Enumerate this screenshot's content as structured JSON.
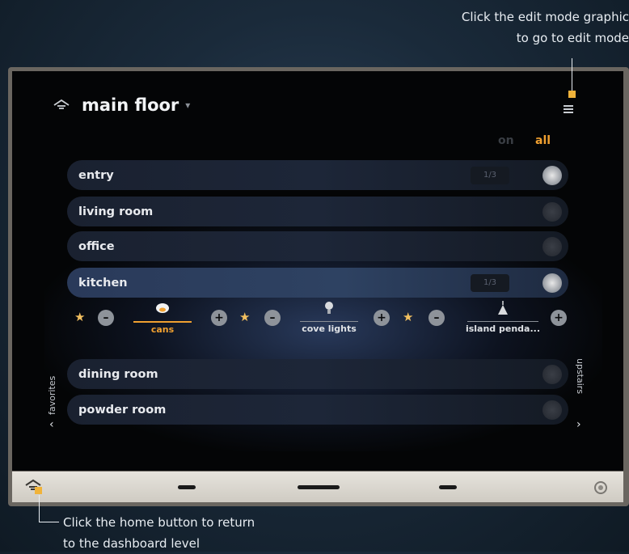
{
  "annotations": {
    "edit_callout_line1": "Click the edit mode graphic",
    "edit_callout_line2": "to go to edit mode",
    "home_callout_line1": "Click the home button to return",
    "home_callout_line2": "to the dashboard level"
  },
  "header": {
    "title": "main floor",
    "caret": "▾",
    "icon": "house-icon",
    "menu_icon": "hamburger-menu-icon"
  },
  "filters": {
    "on_label": "on",
    "all_label": "all",
    "active": "all"
  },
  "rooms": [
    {
      "label": "entry",
      "count": "1/3",
      "state": "on"
    },
    {
      "label": "living room",
      "count": "",
      "state": "dim"
    },
    {
      "label": "office",
      "count": "",
      "state": "dim"
    },
    {
      "label": "kitchen",
      "count": "1/3",
      "state": "on",
      "selected": true
    },
    {
      "label": "dining room",
      "count": "",
      "state": "dim"
    },
    {
      "label": "powder room",
      "count": "",
      "state": "dim"
    }
  ],
  "kitchen_loads": [
    {
      "label": "cans",
      "icon": "ceiling-can-icon",
      "on": true
    },
    {
      "label": "cove lights",
      "icon": "bulb-icon",
      "on": false
    },
    {
      "label": "island penda...",
      "icon": "pendant-icon",
      "on": false
    }
  ],
  "side_tabs": {
    "left": "favorites",
    "right": "upstairs"
  },
  "colors": {
    "accent": "#f0a030",
    "marker": "#f0b33a",
    "bezel_bar": "#dcd8d1"
  }
}
